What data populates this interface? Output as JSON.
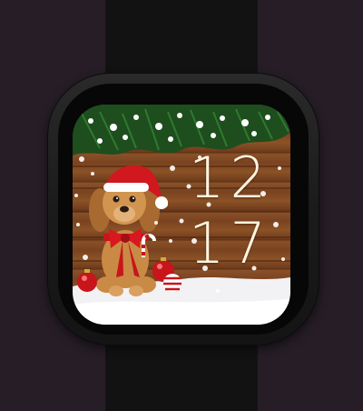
{
  "watch": {
    "hours": "12",
    "minutes": "17"
  },
  "colors": {
    "background": "#261d26",
    "strap": "#121212",
    "wood": "#7a4320",
    "snow": "#f2f2f4",
    "digits": "#fff5e0",
    "ribbon": "#c8151b"
  },
  "icons": {
    "wallpaper": "christmas-puppy-illustration"
  }
}
